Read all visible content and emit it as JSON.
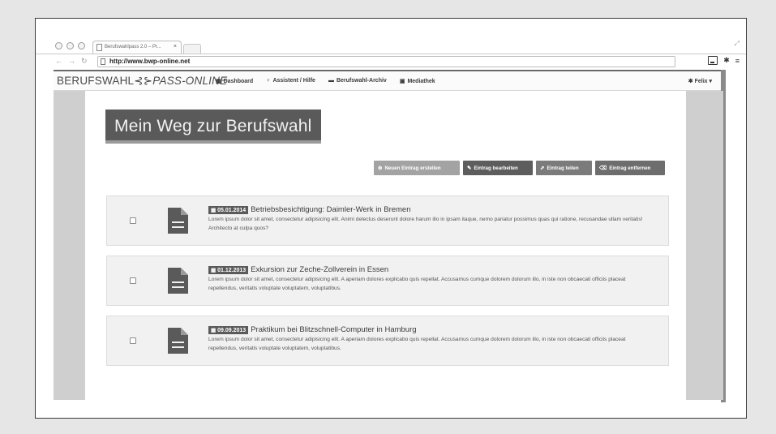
{
  "browser": {
    "tab_title": "Berufswahlpass 2.0 – Pr...",
    "tab_close": "×",
    "url": "http://www.bwp-online.net"
  },
  "navbar": {
    "brand_left": "BERUFSWAHL",
    "brand_right": "PASS-ONLINE",
    "links": [
      {
        "icon": "dashboard-icon",
        "label": "Dashboard"
      },
      {
        "icon": "lightbulb-icon",
        "label": "Assistent / Hilfe"
      },
      {
        "icon": "folder-icon",
        "label": "Berufswahl-Archiv"
      },
      {
        "icon": "image-icon",
        "label": "Mediathek"
      }
    ],
    "user_label": "Felix"
  },
  "page": {
    "title": "Mein Weg zur Berufswahl"
  },
  "actions": {
    "new_label": "Neuen Eintrag erstellen",
    "edit_label": "Eintrag bearbeiten",
    "share_label": "Eintrag teilen",
    "delete_label": "Eintrag entfernen"
  },
  "entries": [
    {
      "date": "05.01.2014",
      "title": "Betriebsbesichtigung: Daimler-Werk in Bremen",
      "text": "Lorem ipsum dolor sit amet, consectetur adipisicing elit. Animi delectus deserunt dolore harum illo in ipsam itaque, nemo pariatur possimus quas qui ratione, recusandae ullam veritatis! Architecto at culpa quos?"
    },
    {
      "date": "01.12.2013",
      "title": "Exkursion zur Zeche-Zollverein in Essen",
      "text": "Lorem ipsum dolor sit amet, consectetur adipisicing elit. A aperiam dolores explicabo quis repellat. Accusamus cumque dolorem dolorum illo, in iste non obcaecati officiis placeat repellendus, veritatis voluptate voluptatem, voluptatibus."
    },
    {
      "date": "09.09.2013",
      "title": "Praktikum bei Blitzschnell-Computer in Hamburg",
      "text": "Lorem ipsum dolor sit amet, consectetur adipisicing elit. A aperiam dolores explicabo quis repellat. Accusamus cumque dolorem dolorum illo, in iste non obcaecati officiis placeat repellendus, veritatis voluptate voluptatem, voluptatibus."
    }
  ],
  "colors": {
    "header_dark": "#5a5a5a",
    "entry_bg": "#f1f1f1",
    "page_bg": "#cfcfcf"
  }
}
